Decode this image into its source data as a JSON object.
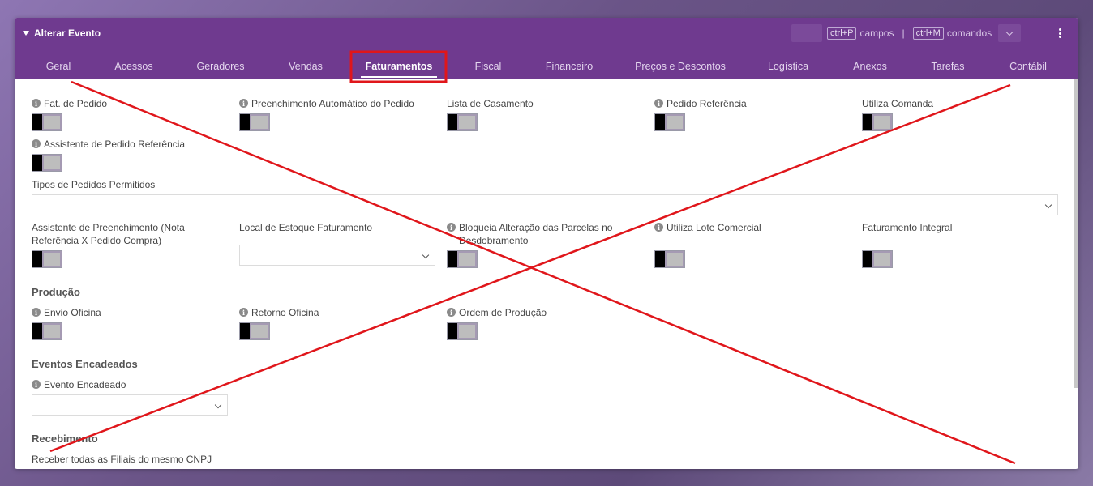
{
  "window": {
    "title": "Alterar Evento",
    "shortcut_fields_key": "ctrl+P",
    "shortcut_fields_label": "campos",
    "separator": "|",
    "shortcut_commands_key": "ctrl+M",
    "shortcut_commands_label": "comandos"
  },
  "tabs": [
    {
      "label": "Geral"
    },
    {
      "label": "Acessos"
    },
    {
      "label": "Geradores"
    },
    {
      "label": "Vendas"
    },
    {
      "label": "Faturamentos",
      "active": true
    },
    {
      "label": "Fiscal"
    },
    {
      "label": "Financeiro"
    },
    {
      "label": "Preços e Descontos"
    },
    {
      "label": "Logística"
    },
    {
      "label": "Anexos"
    },
    {
      "label": "Tarefas"
    },
    {
      "label": "Contábil"
    }
  ],
  "fields": {
    "fat_pedido": "Fat. de Pedido",
    "preenchimento_auto": "Preenchimento Automático do Pedido",
    "lista_casamento": "Lista de Casamento",
    "pedido_referencia": "Pedido Referência",
    "utiliza_comanda": "Utiliza Comanda",
    "assistente_pedido_ref": "Assistente de Pedido Referência",
    "tipos_pedidos": "Tipos de Pedidos Permitidos",
    "assistente_preench_l1": "Assistente de Preenchimento (Nota",
    "assistente_preench_l2": "Referência X Pedido Compra)",
    "local_estoque": "Local de Estoque Faturamento",
    "bloqueia_l1": "Bloqueia Alteração das Parcelas no",
    "bloqueia_l2": "Desdobramento",
    "lote_comercial": "Utiliza Lote Comercial",
    "faturamento_integral": "Faturamento Integral",
    "envio_oficina": "Envio Oficina",
    "retorno_oficina": "Retorno Oficina",
    "ordem_producao": "Ordem de Produção",
    "evento_encadeado": "Evento Encadeado",
    "receber_filiais": "Receber todas as Filiais do mesmo CNPJ"
  },
  "sections": {
    "producao": "Produção",
    "eventos_encadeados": "Eventos Encadeados",
    "recebimento": "Recebimento"
  },
  "annotation": {
    "highlight_color": "#e0161b",
    "cross_color": "#e0161b"
  }
}
